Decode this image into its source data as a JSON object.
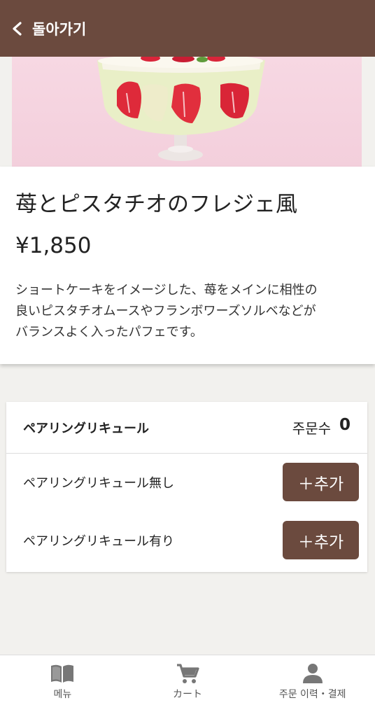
{
  "header": {
    "back_label": "돌아가기"
  },
  "product": {
    "title": "苺とピスタチオのフレジェ風",
    "price": "¥1,850",
    "description_lines": [
      "ショートケーキをイメージした、苺をメインに相性の",
      "良いピスタチオムースやフランボワーズソルベなどが",
      "バランスよく入ったパフェです。"
    ]
  },
  "options": {
    "group_title": "ペアリングリキュール",
    "count_label": "주문수",
    "count_value": "0",
    "items": [
      {
        "label": "ペアリングリキュール無し",
        "button": "＋추가"
      },
      {
        "label": "ペアリングリキュール有り",
        "button": "＋추가"
      }
    ]
  },
  "nav": {
    "items": [
      {
        "label": "메뉴",
        "icon": "book-icon"
      },
      {
        "label": "カート",
        "icon": "cart-icon"
      },
      {
        "label": "주문 이력・결제",
        "icon": "person-icon"
      }
    ]
  },
  "colors": {
    "brand": "#6b4a3e",
    "background": "#f2f1ee"
  }
}
